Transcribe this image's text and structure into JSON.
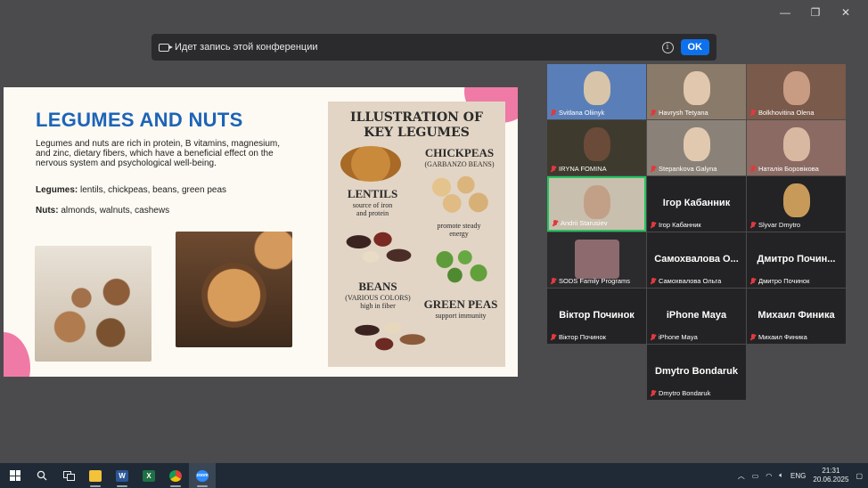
{
  "window": {
    "min": "—",
    "restore": "❐",
    "close": "✕"
  },
  "banner": {
    "text": "Идет запись этой конференции",
    "info": "i",
    "ok": "OK"
  },
  "slide": {
    "title": "LEGUMES AND NUTS",
    "body": "Legumes and nuts are rich in protein, B vitamins, magnesium, and zinc, dietary fibers, which have a beneficial effect on the nervous system and psychological well-being.",
    "legumes_label": "Legumes:",
    "legumes_text": " lentils, chickpeas, beans, green peas",
    "nuts_label": "Nuts:",
    "nuts_text": " almonds, walnuts, cashews",
    "illustration": {
      "title_line1": "ILLUSTRATION OF",
      "title_line2": "KEY LEGUMES",
      "chickpeas": "CHICKPEAS",
      "chickpeas_sub": "(GARBANZO BEANS)",
      "lentils": "LENTILS",
      "lentils_sub1": "source of iron",
      "lentils_sub2": "and protein",
      "steady1": "promote steady",
      "steady2": "energy",
      "beans": "BEANS",
      "beans_sub1": "(VARIOUS COLORS)",
      "beans_sub2": "high in fiber",
      "peas": "GREEN PEAS",
      "peas_sub": "support immunity"
    }
  },
  "participants": [
    {
      "name": "Svitlana Oliinyk",
      "big": ""
    },
    {
      "name": "Havrysh Tetyana",
      "big": ""
    },
    {
      "name": "Bolkhovitina Olena",
      "big": ""
    },
    {
      "name": "IRYNA FOMINA",
      "big": ""
    },
    {
      "name": "Stepankova Galyna",
      "big": ""
    },
    {
      "name": "Наталія Боровікова",
      "big": ""
    },
    {
      "name": "Andrii Starusiev",
      "big": ""
    },
    {
      "name": "Ігор Кабанник",
      "big": "Ігор Кабанник"
    },
    {
      "name": "Slyvar Dmytro",
      "big": ""
    },
    {
      "name": "SODS Family Programs",
      "big": ""
    },
    {
      "name": "Самохвалова Ольга",
      "big": "Самохвалова О..."
    },
    {
      "name": "Дмитро Починок",
      "big": "Дмитро Почин..."
    },
    {
      "name": "Віктор Починок",
      "big": "Віктор Починок"
    },
    {
      "name": "iPhone Maya",
      "big": "iPhone Maya"
    },
    {
      "name": "Михаил Финика",
      "big": "Михаил Финика"
    },
    {
      "name": "Dmytro Bondaruk",
      "big": "Dmytro Bondaruk"
    }
  ],
  "taskbar": {
    "tray_lang": "ENG",
    "time": "21:31",
    "date": "20.06.2025",
    "word": "W",
    "excel": "X",
    "zoom": "zoom"
  }
}
